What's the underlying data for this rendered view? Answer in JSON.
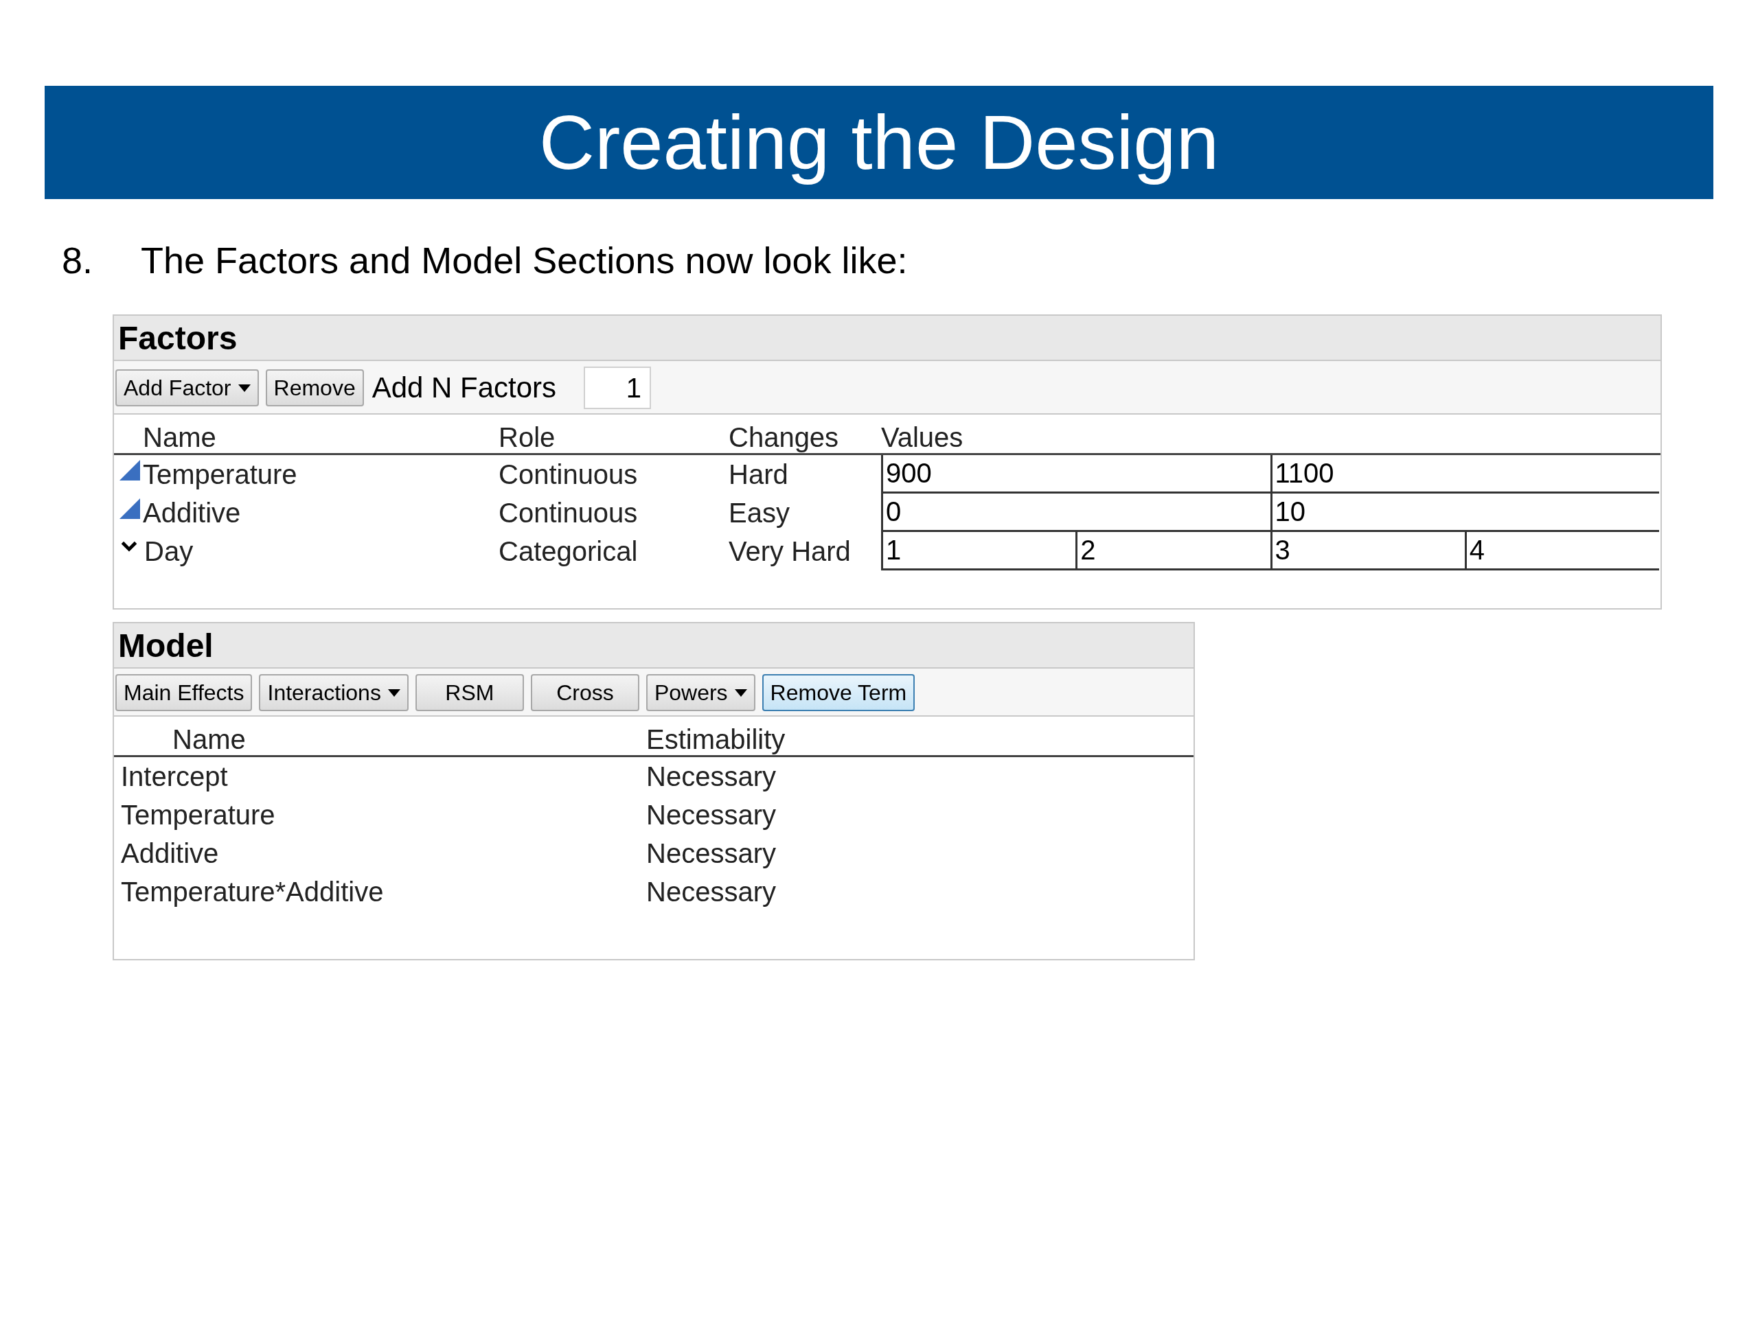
{
  "banner": {
    "title": "Creating the Design"
  },
  "step": {
    "number": "8.",
    "text": "The Factors and Model Sections now look like:"
  },
  "factors": {
    "title": "Factors",
    "buttons": [
      {
        "label": "Add Factor",
        "dropdown": true
      },
      {
        "label": "Remove",
        "dropdown": false
      }
    ],
    "add_n_label": "Add N Factors",
    "add_n_value": "1",
    "columns": [
      "Name",
      "Role",
      "Changes",
      "Values"
    ],
    "rows": [
      {
        "kind": "continuous",
        "name": "Temperature",
        "role": "Continuous",
        "changes": "Hard",
        "values": [
          "900",
          "1100"
        ]
      },
      {
        "kind": "continuous",
        "name": "Additive",
        "role": "Continuous",
        "changes": "Easy",
        "values": [
          "0",
          "10"
        ]
      },
      {
        "kind": "categorical",
        "name": "Day",
        "role": "Categorical",
        "changes": "Very Hard",
        "values": [
          "1",
          "2",
          "3",
          "4"
        ]
      }
    ]
  },
  "model": {
    "title": "Model",
    "buttons": [
      {
        "label": "Main Effects",
        "dropdown": false,
        "highlighted": false
      },
      {
        "label": "Interactions",
        "dropdown": true,
        "highlighted": false
      },
      {
        "label": "RSM",
        "dropdown": false,
        "highlighted": false
      },
      {
        "label": "Cross",
        "dropdown": false,
        "highlighted": false
      },
      {
        "label": "Powers",
        "dropdown": true,
        "highlighted": false
      },
      {
        "label": "Remove Term",
        "dropdown": false,
        "highlighted": true
      }
    ],
    "columns": [
      "Name",
      "Estimability"
    ],
    "rows": [
      {
        "name": "Intercept",
        "estimability": "Necessary"
      },
      {
        "name": "Temperature",
        "estimability": "Necessary"
      },
      {
        "name": "Additive",
        "estimability": "Necessary"
      },
      {
        "name": "Temperature*Additive",
        "estimability": "Necessary"
      }
    ]
  }
}
